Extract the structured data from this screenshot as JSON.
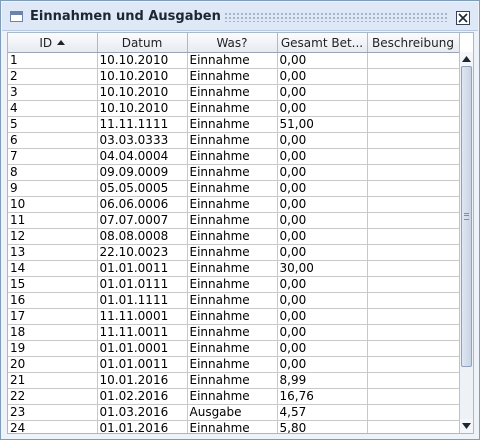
{
  "window": {
    "title": "Einnahmen und Ausgaben"
  },
  "table": {
    "columns": [
      {
        "label": "ID",
        "sorted": "ascending"
      },
      {
        "label": "Datum"
      },
      {
        "label": "Was?"
      },
      {
        "label": "Gesamt Bet..."
      },
      {
        "label": "Beschreibung"
      }
    ],
    "rows": [
      [
        "1",
        "10.10.2010",
        "Einnahme",
        "0,00",
        ""
      ],
      [
        "2",
        "10.10.2010",
        "Einnahme",
        "0,00",
        ""
      ],
      [
        "3",
        "10.10.2010",
        "Einnahme",
        "0,00",
        ""
      ],
      [
        "4",
        "10.10.2010",
        "Einnahme",
        "0,00",
        ""
      ],
      [
        "5",
        "11.11.1111",
        "Einnahme",
        "51,00",
        ""
      ],
      [
        "6",
        "03.03.0333",
        "Einnahme",
        "0,00",
        ""
      ],
      [
        "7",
        "04.04.0004",
        "Einnahme",
        "0,00",
        ""
      ],
      [
        "8",
        "09.09.0009",
        "Einnahme",
        "0,00",
        ""
      ],
      [
        "9",
        "05.05.0005",
        "Einnahme",
        "0,00",
        ""
      ],
      [
        "10",
        "06.06.0006",
        "Einnahme",
        "0,00",
        ""
      ],
      [
        "11",
        "07.07.0007",
        "Einnahme",
        "0,00",
        ""
      ],
      [
        "12",
        "08.08.0008",
        "Einnahme",
        "0,00",
        ""
      ],
      [
        "13",
        "22.10.0023",
        "Einnahme",
        "0,00",
        ""
      ],
      [
        "14",
        "01.01.0011",
        "Einnahme",
        "30,00",
        ""
      ],
      [
        "15",
        "01.01.0111",
        "Einnahme",
        "0,00",
        ""
      ],
      [
        "16",
        "01.01.1111",
        "Einnahme",
        "0,00",
        ""
      ],
      [
        "17",
        "11.11.0001",
        "Einnahme",
        "0,00",
        ""
      ],
      [
        "18",
        "11.11.0011",
        "Einnahme",
        "0,00",
        ""
      ],
      [
        "19",
        "01.01.0001",
        "Einnahme",
        "0,00",
        ""
      ],
      [
        "20",
        "01.01.0011",
        "Einnahme",
        "0,00",
        ""
      ],
      [
        "21",
        "10.01.2016",
        "Einnahme",
        "8,99",
        ""
      ],
      [
        "22",
        "01.02.2016",
        "Einnahme",
        "16,76",
        ""
      ],
      [
        "23",
        "01.03.2016",
        "Ausgabe",
        "4,57",
        ""
      ],
      [
        "24",
        "01.01.2016",
        "Einnahme",
        "5,80",
        ""
      ]
    ]
  }
}
